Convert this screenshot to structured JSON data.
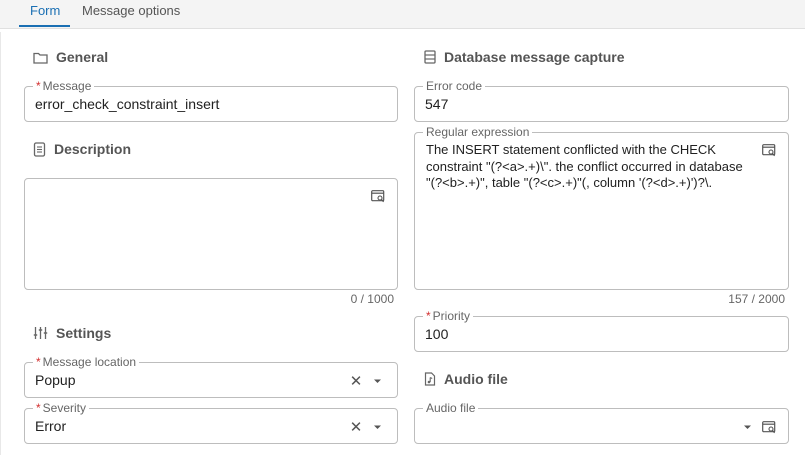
{
  "tabs": [
    {
      "label": "Form",
      "active": true
    },
    {
      "label": "Message options",
      "active": false
    }
  ],
  "sections": {
    "general": "General",
    "description": "Description",
    "settings": "Settings",
    "db_capture": "Database message capture",
    "audio": "Audio file"
  },
  "fields": {
    "message": {
      "label": "Message",
      "required": "*",
      "value": "error_check_constraint_insert"
    },
    "description": {
      "value": "",
      "counter": "0 / 1000"
    },
    "message_location": {
      "label": "Message location",
      "required": "*",
      "value": "Popup"
    },
    "severity": {
      "label": "Severity",
      "required": "*",
      "value": "Error"
    },
    "error_code": {
      "label": "Error code",
      "value": "547"
    },
    "regex": {
      "label": "Regular expression",
      "value": "The INSERT statement conflicted with the CHECK constraint \"(?<a>.+)\\\". the conflict occurred in database \"(?<b>.+)\", table \"(?<c>.+)\"(, column '(?<d>.+)')?\\.",
      "counter": "157 / 2000"
    },
    "priority": {
      "label": "Priority",
      "required": "*",
      "value": "100"
    },
    "audio_file": {
      "label": "Audio file",
      "value": ""
    }
  },
  "colors": {
    "accent": "#1a6fb3",
    "required": "#d32f2f",
    "border": "#bdbdbd"
  }
}
